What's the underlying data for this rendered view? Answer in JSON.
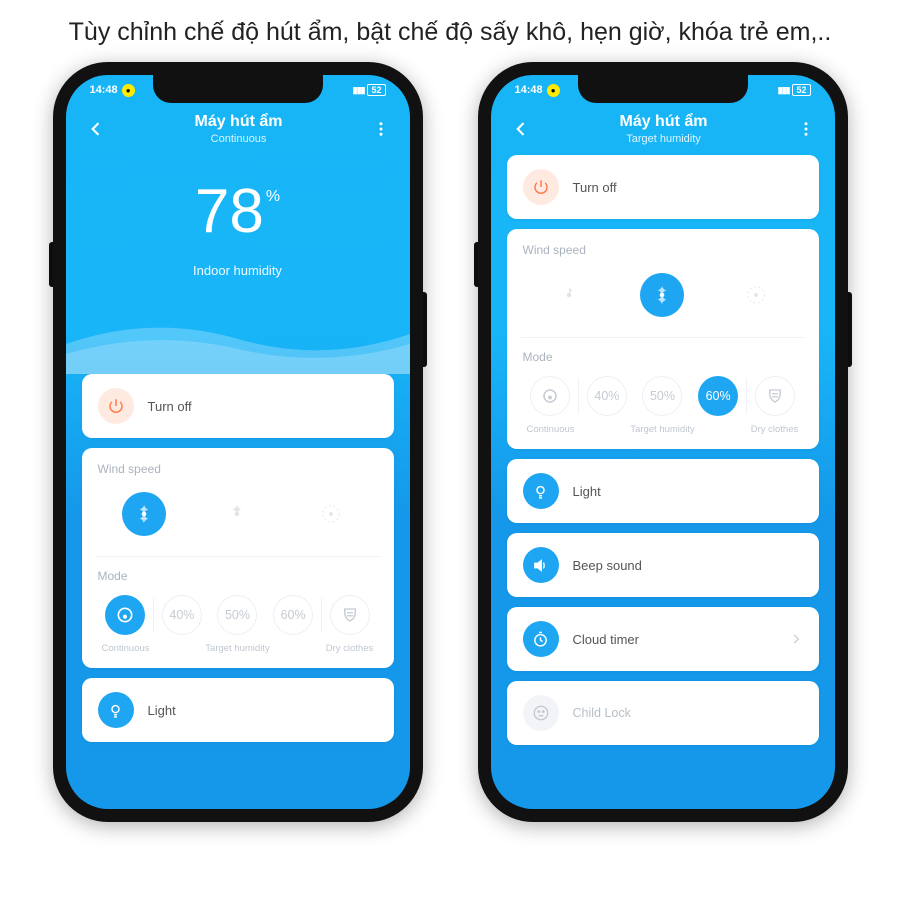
{
  "heading": "Tùy chỉnh chế độ hút ẩm, bật chế độ sấy khô, hẹn giờ, khóa trẻ em,..",
  "status": {
    "time": "14:48",
    "battery": "52"
  },
  "left": {
    "title": "Máy hút ẩm",
    "subtitle": "Continuous",
    "humidity_value": "78",
    "humidity_unit": "%",
    "humidity_label": "Indoor humidity",
    "turn_off": "Turn off",
    "wind_speed_title": "Wind speed",
    "mode_title": "Mode",
    "mode_continuous": "Continuous",
    "mode_target": "Target humidity",
    "mode_dry": "Dry clothes",
    "pct_40": "40%",
    "pct_50": "50%",
    "pct_60": "60%",
    "light": "Light"
  },
  "right": {
    "title": "Máy hút ẩm",
    "subtitle": "Target humidity",
    "turn_off": "Turn off",
    "wind_speed_title": "Wind speed",
    "mode_title": "Mode",
    "mode_continuous": "Continuous",
    "mode_target": "Target humidity",
    "mode_dry": "Dry clothes",
    "pct_40": "40%",
    "pct_50": "50%",
    "pct_60": "60%",
    "light": "Light",
    "beep": "Beep sound",
    "cloud_timer": "Cloud timer",
    "child_lock": "Child Lock"
  }
}
